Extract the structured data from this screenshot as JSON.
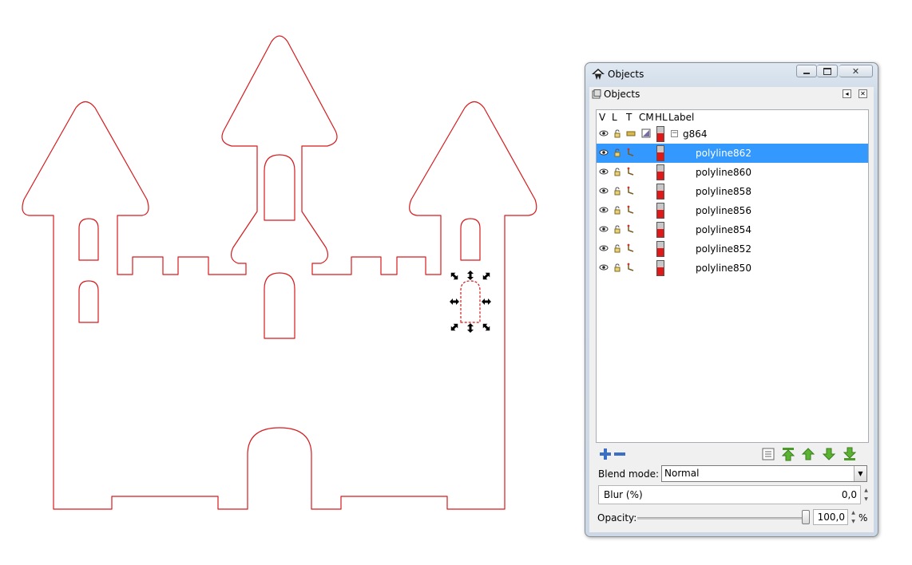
{
  "window": {
    "title": "Objects",
    "minimize_icon": "minimize-icon",
    "restore_icon": "restore-icon",
    "close_icon": "close-icon"
  },
  "dock": {
    "title": "Objects"
  },
  "tree": {
    "headers": {
      "v": "V",
      "l": "L",
      "t": "T",
      "cm": "CM",
      "hl": "HL",
      "label": "Label"
    },
    "rows": [
      {
        "label": "g864",
        "kind": "group",
        "expanded": true,
        "selected": false
      },
      {
        "label": "polyline862",
        "kind": "path",
        "selected": true
      },
      {
        "label": "polyline860",
        "kind": "path",
        "selected": false
      },
      {
        "label": "polyline858",
        "kind": "path",
        "selected": false
      },
      {
        "label": "polyline856",
        "kind": "path",
        "selected": false
      },
      {
        "label": "polyline854",
        "kind": "path",
        "selected": false
      },
      {
        "label": "polyline852",
        "kind": "path",
        "selected": false
      },
      {
        "label": "polyline850",
        "kind": "path",
        "selected": false
      }
    ]
  },
  "toolbar": {
    "add": "add-icon",
    "remove": "remove-icon",
    "properties": "properties-icon",
    "raise_top": "raise-to-top-icon",
    "raise": "raise-icon",
    "lower": "lower-icon",
    "lower_bottom": "lower-to-bottom-icon"
  },
  "blend": {
    "label": "Blend mode:",
    "value": "Normal"
  },
  "blur": {
    "label": "Blur (%)",
    "value": "0,0"
  },
  "opacity": {
    "label": "Opacity:",
    "value": "100,0",
    "unit": "%",
    "level": 1.0
  },
  "colors": {
    "stroke": "#d7191c",
    "selection": "#3399ff",
    "hl_red": "#e01818"
  }
}
